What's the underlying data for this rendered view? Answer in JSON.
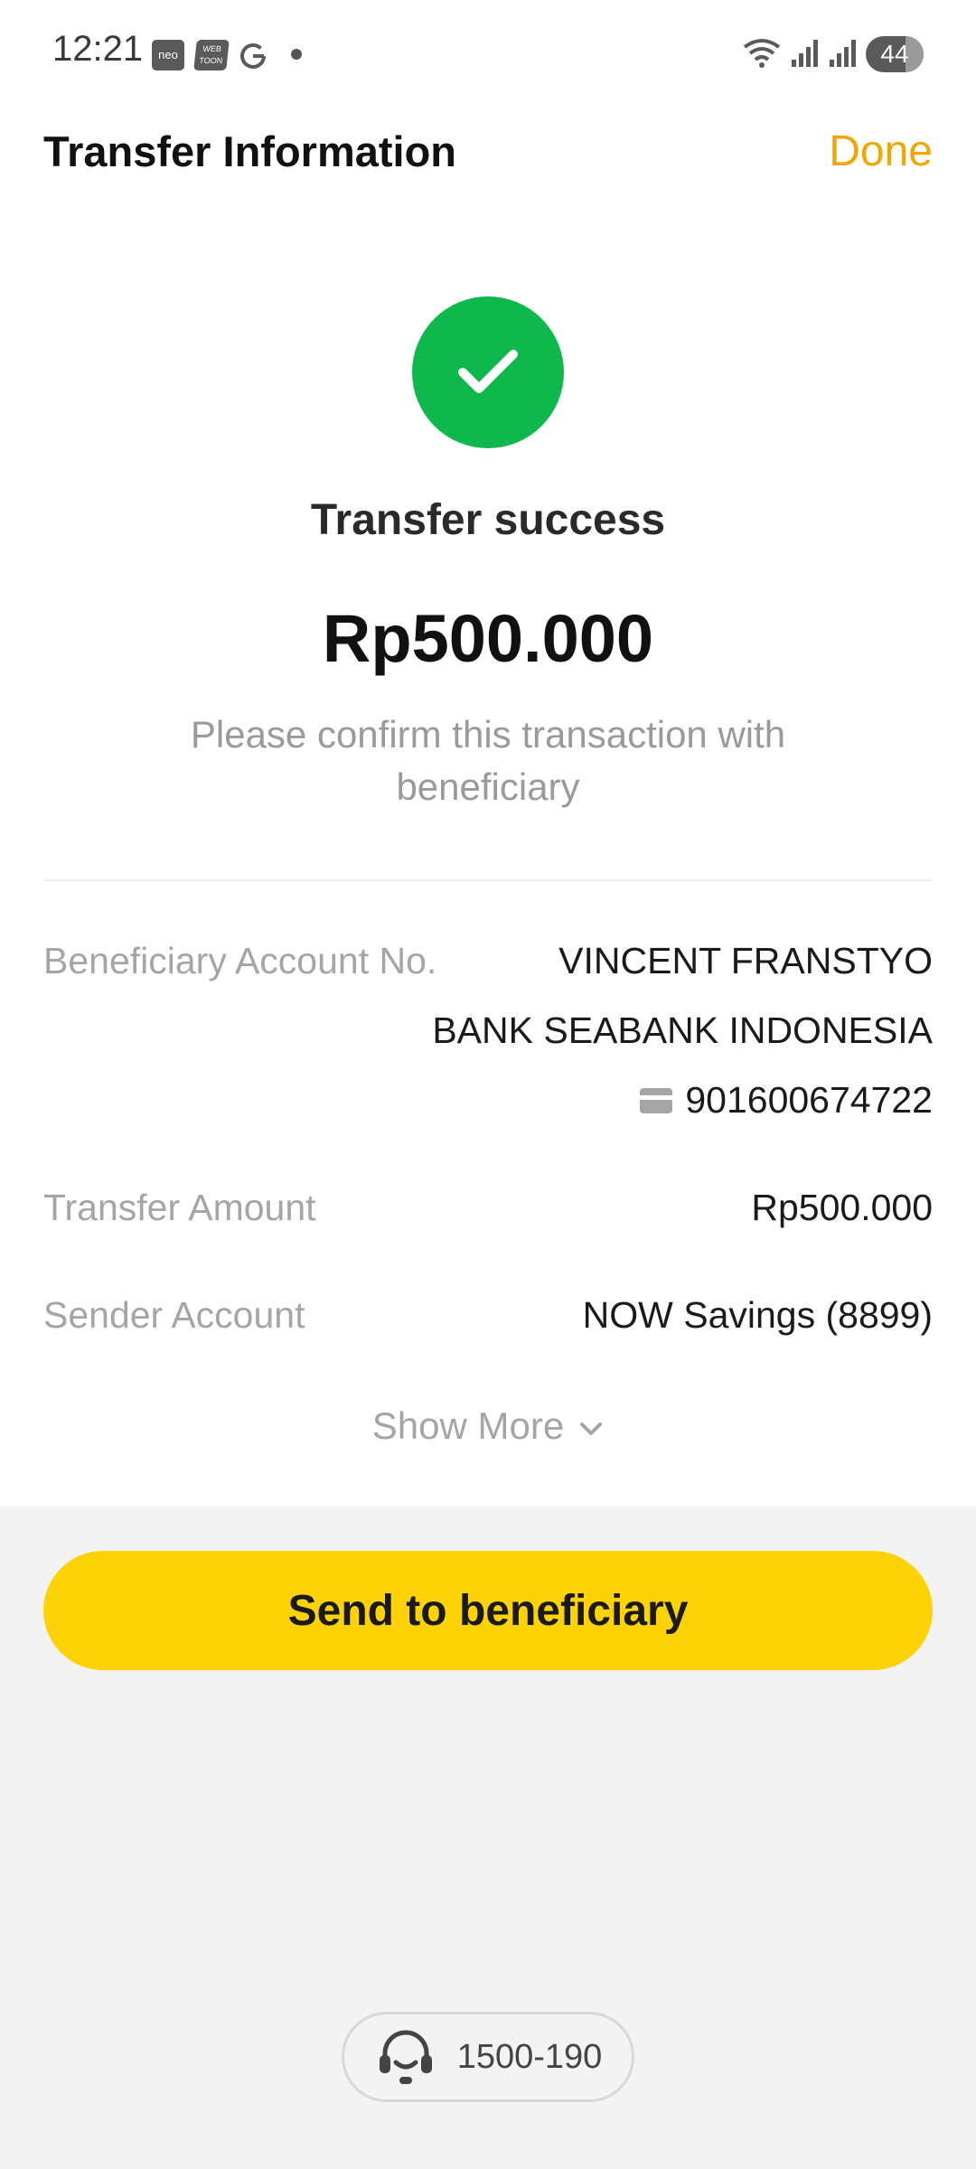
{
  "status_bar": {
    "time": "12:21",
    "apps": [
      "neo",
      "WEB TOON",
      "G"
    ],
    "battery": "44"
  },
  "header": {
    "title": "Transfer Information",
    "done_label": "Done"
  },
  "result": {
    "icon": "check-icon",
    "title": "Transfer success",
    "amount": "Rp500.000",
    "note": "Please confirm this transaction with beneficiary"
  },
  "details": {
    "beneficiary_label": "Beneficiary Account No.",
    "beneficiary_name": "VINCENT FRANSTYO",
    "beneficiary_bank": "BANK SEABANK INDONESIA",
    "beneficiary_account": "901600674722",
    "amount_label": "Transfer Amount",
    "amount_value": "Rp500.000",
    "sender_label": "Sender Account",
    "sender_value": "NOW Savings (8899)"
  },
  "show_more_label": "Show More",
  "primary_action": "Send to beneficiary",
  "helpline": {
    "icon": "headset-icon",
    "number": "1500-190"
  },
  "colors": {
    "accent": "#f0a800",
    "success": "#0fb84c",
    "button": "#fdd206"
  }
}
